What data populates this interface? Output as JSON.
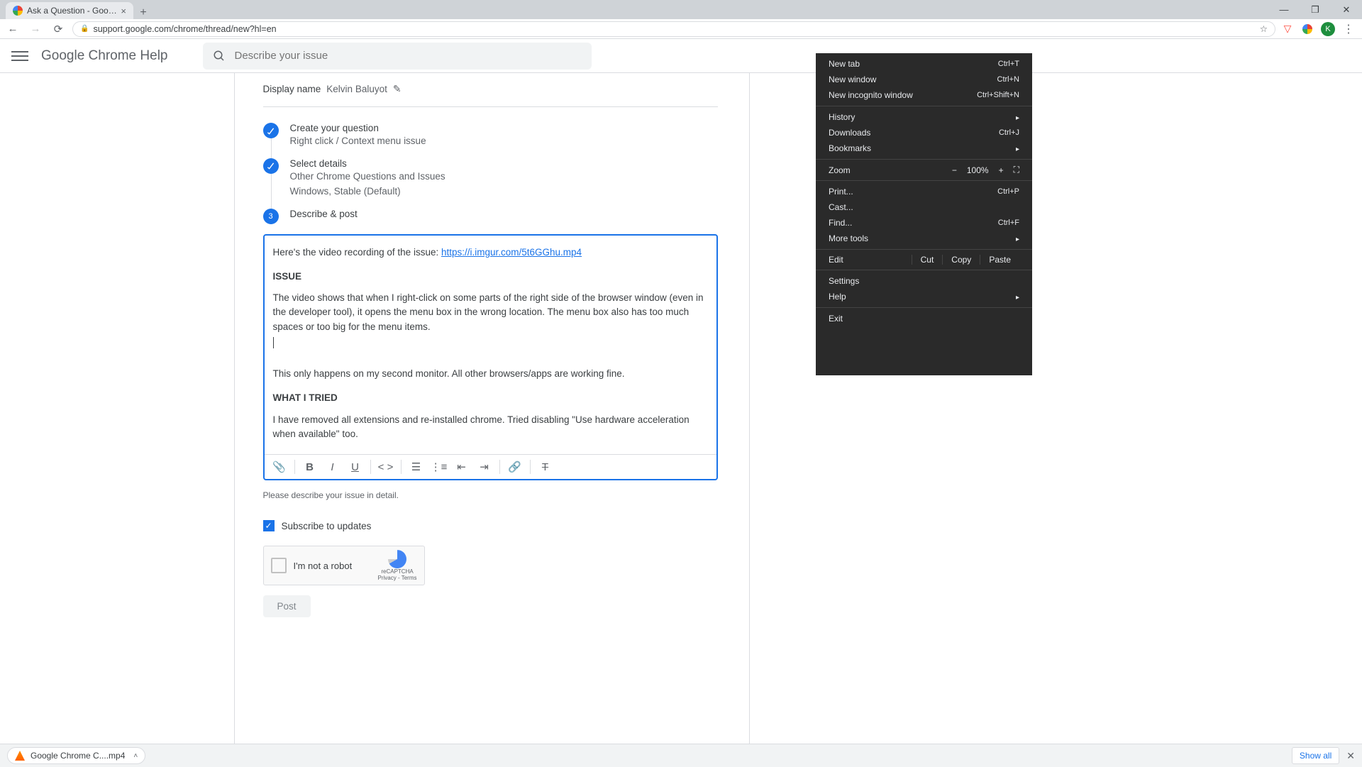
{
  "browser": {
    "tab_title": "Ask a Question - Google Chrome",
    "url": "support.google.com/chrome/thread/new?hl=en",
    "avatar_letter": "K"
  },
  "header": {
    "brand": "Google Chrome Help",
    "search_placeholder": "Describe your issue"
  },
  "display_name": {
    "label": "Display name",
    "value": "Kelvin Baluyot"
  },
  "steps": {
    "s1": {
      "title": "Create your question",
      "sub": "Right click / Context menu issue"
    },
    "s2": {
      "title": "Select details",
      "sub1": "Other Chrome Questions and Issues",
      "sub2": "Windows, Stable (Default)"
    },
    "s3": {
      "num": "3",
      "title": "Describe & post"
    }
  },
  "editor": {
    "line1_prefix": "Here's the video recording of the issue: ",
    "link": "https://i.imgur.com/5t6GGhu.mp4",
    "h_issue": "ISSUE",
    "body1": "The video shows that when I right-click on some parts of the right side of the browser window (even in the developer tool), it opens the menu box in the wrong location. The menu box also has too much spaces or too big for the menu items.",
    "body2": "This only happens on my second monitor. All other browsers/apps are working fine.",
    "h_tried": "WHAT I TRIED",
    "body3": "I have removed all extensions and re-installed chrome. Tried disabling \"Use hardware acceleration when available\" too."
  },
  "helper": "Please describe your issue in detail.",
  "subscribe": "Subscribe to updates",
  "captcha": {
    "label": "I'm not a robot",
    "brand": "reCAPTCHA",
    "terms": "Privacy - Terms"
  },
  "post_btn": "Post",
  "ctx": {
    "new_tab": "New tab",
    "new_tab_k": "Ctrl+T",
    "new_window": "New window",
    "new_window_k": "Ctrl+N",
    "incognito": "New incognito window",
    "incognito_k": "Ctrl+Shift+N",
    "history": "History",
    "downloads": "Downloads",
    "downloads_k": "Ctrl+J",
    "bookmarks": "Bookmarks",
    "zoom": "Zoom",
    "zoom_minus": "−",
    "zoom_val": "100%",
    "zoom_plus": "+",
    "fullscreen": "⛶",
    "print": "Print...",
    "print_k": "Ctrl+P",
    "cast": "Cast...",
    "find": "Find...",
    "find_k": "Ctrl+F",
    "more_tools": "More tools",
    "edit": "Edit",
    "cut": "Cut",
    "copy": "Copy",
    "paste": "Paste",
    "settings": "Settings",
    "help": "Help",
    "exit": "Exit"
  },
  "dl": {
    "file": "Google Chrome C....mp4",
    "show_all": "Show all"
  }
}
